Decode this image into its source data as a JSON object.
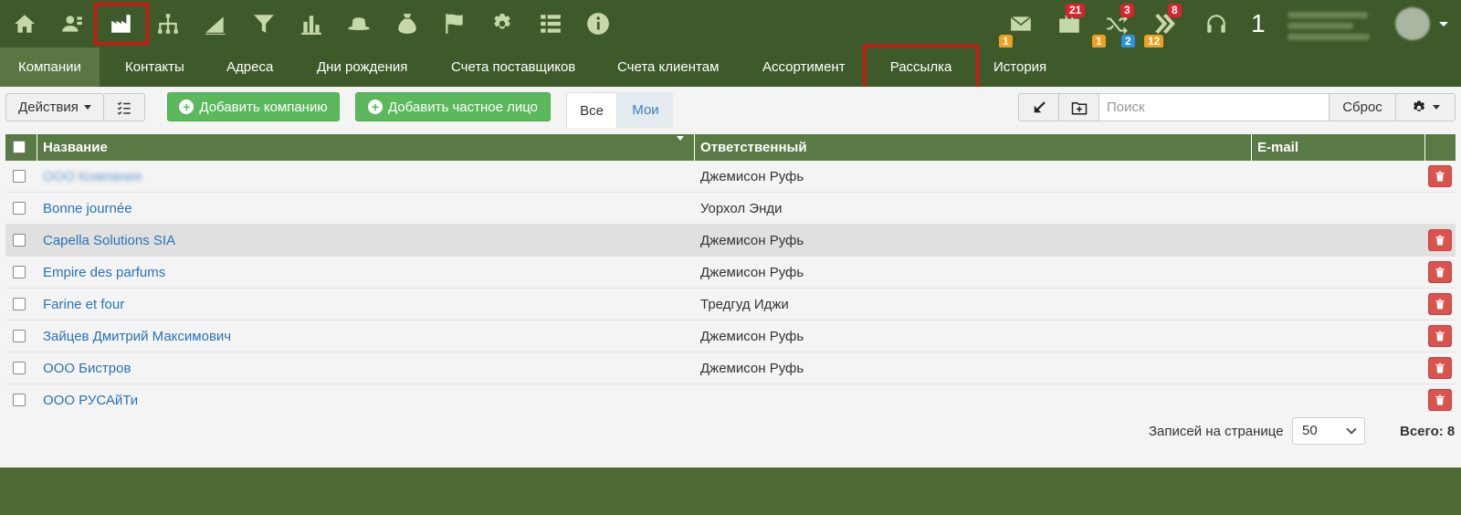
{
  "topbar": {
    "icons": [
      "home-icon",
      "contacts-icon",
      "companies-icon",
      "org-structure-icon",
      "growth-chart-icon",
      "filter-icon",
      "bar-chart-icon",
      "hat-icon",
      "money-bag-icon",
      "flag-icon",
      "gear-icon",
      "list-icon",
      "info-icon"
    ],
    "badges": {
      "mail_count": "1",
      "tasks_count": "21",
      "shuffle_top": "3",
      "shuffle_left": "1",
      "shuffle_mid": "2",
      "chevrons_top": "8",
      "chevrons_bottom": "12"
    },
    "number": "1"
  },
  "nav": {
    "tabs": [
      "Компании",
      "Контакты",
      "Адреса",
      "Дни рождения",
      "Счета поставщиков",
      "Счета клиентам",
      "Ассортимент",
      "Рассылка",
      "История"
    ]
  },
  "toolbar": {
    "actions_label": "Действия",
    "add_company_label": "Добавить компанию",
    "add_person_label": "Добавить частное лицо",
    "tab_all": "Все",
    "tab_mine": "Мои",
    "search_placeholder": "Поиск",
    "reset_label": "Сброс"
  },
  "table": {
    "columns": [
      "Название",
      "Ответственный",
      "E-mail"
    ],
    "rows": [
      {
        "name": "ООО Компания",
        "responsible": "Джемисон Руфь",
        "email": "",
        "blurred": true
      },
      {
        "name": "Bonne journée",
        "responsible": "Уорхол Энди",
        "email": ""
      },
      {
        "name": "Capella Solutions SIA",
        "responsible": "Джемисон Руфь",
        "email": ""
      },
      {
        "name": "Empire des parfums",
        "responsible": "Джемисон Руфь",
        "email": ""
      },
      {
        "name": "Farine et four",
        "responsible": "Тредгуд Иджи",
        "email": ""
      },
      {
        "name": "Зайцев Дмитрий Максимович",
        "responsible": "Джемисон Руфь",
        "email": ""
      },
      {
        "name": "ООО Бистров",
        "responsible": "Джемисон Руфь",
        "email": ""
      },
      {
        "name": "ООО РУСАйТи",
        "responsible": "",
        "email": ""
      }
    ]
  },
  "footer": {
    "per_page_label": "Записей на странице",
    "per_page_value": "50",
    "total_label": "Всего: 8"
  },
  "colors": {
    "header_green": "#3f5a2a",
    "table_header_green": "#5a7a45",
    "button_green": "#5cb85c",
    "highlight_red": "#e01010",
    "delete_red": "#d9534f",
    "link_blue": "#2a72b8"
  }
}
